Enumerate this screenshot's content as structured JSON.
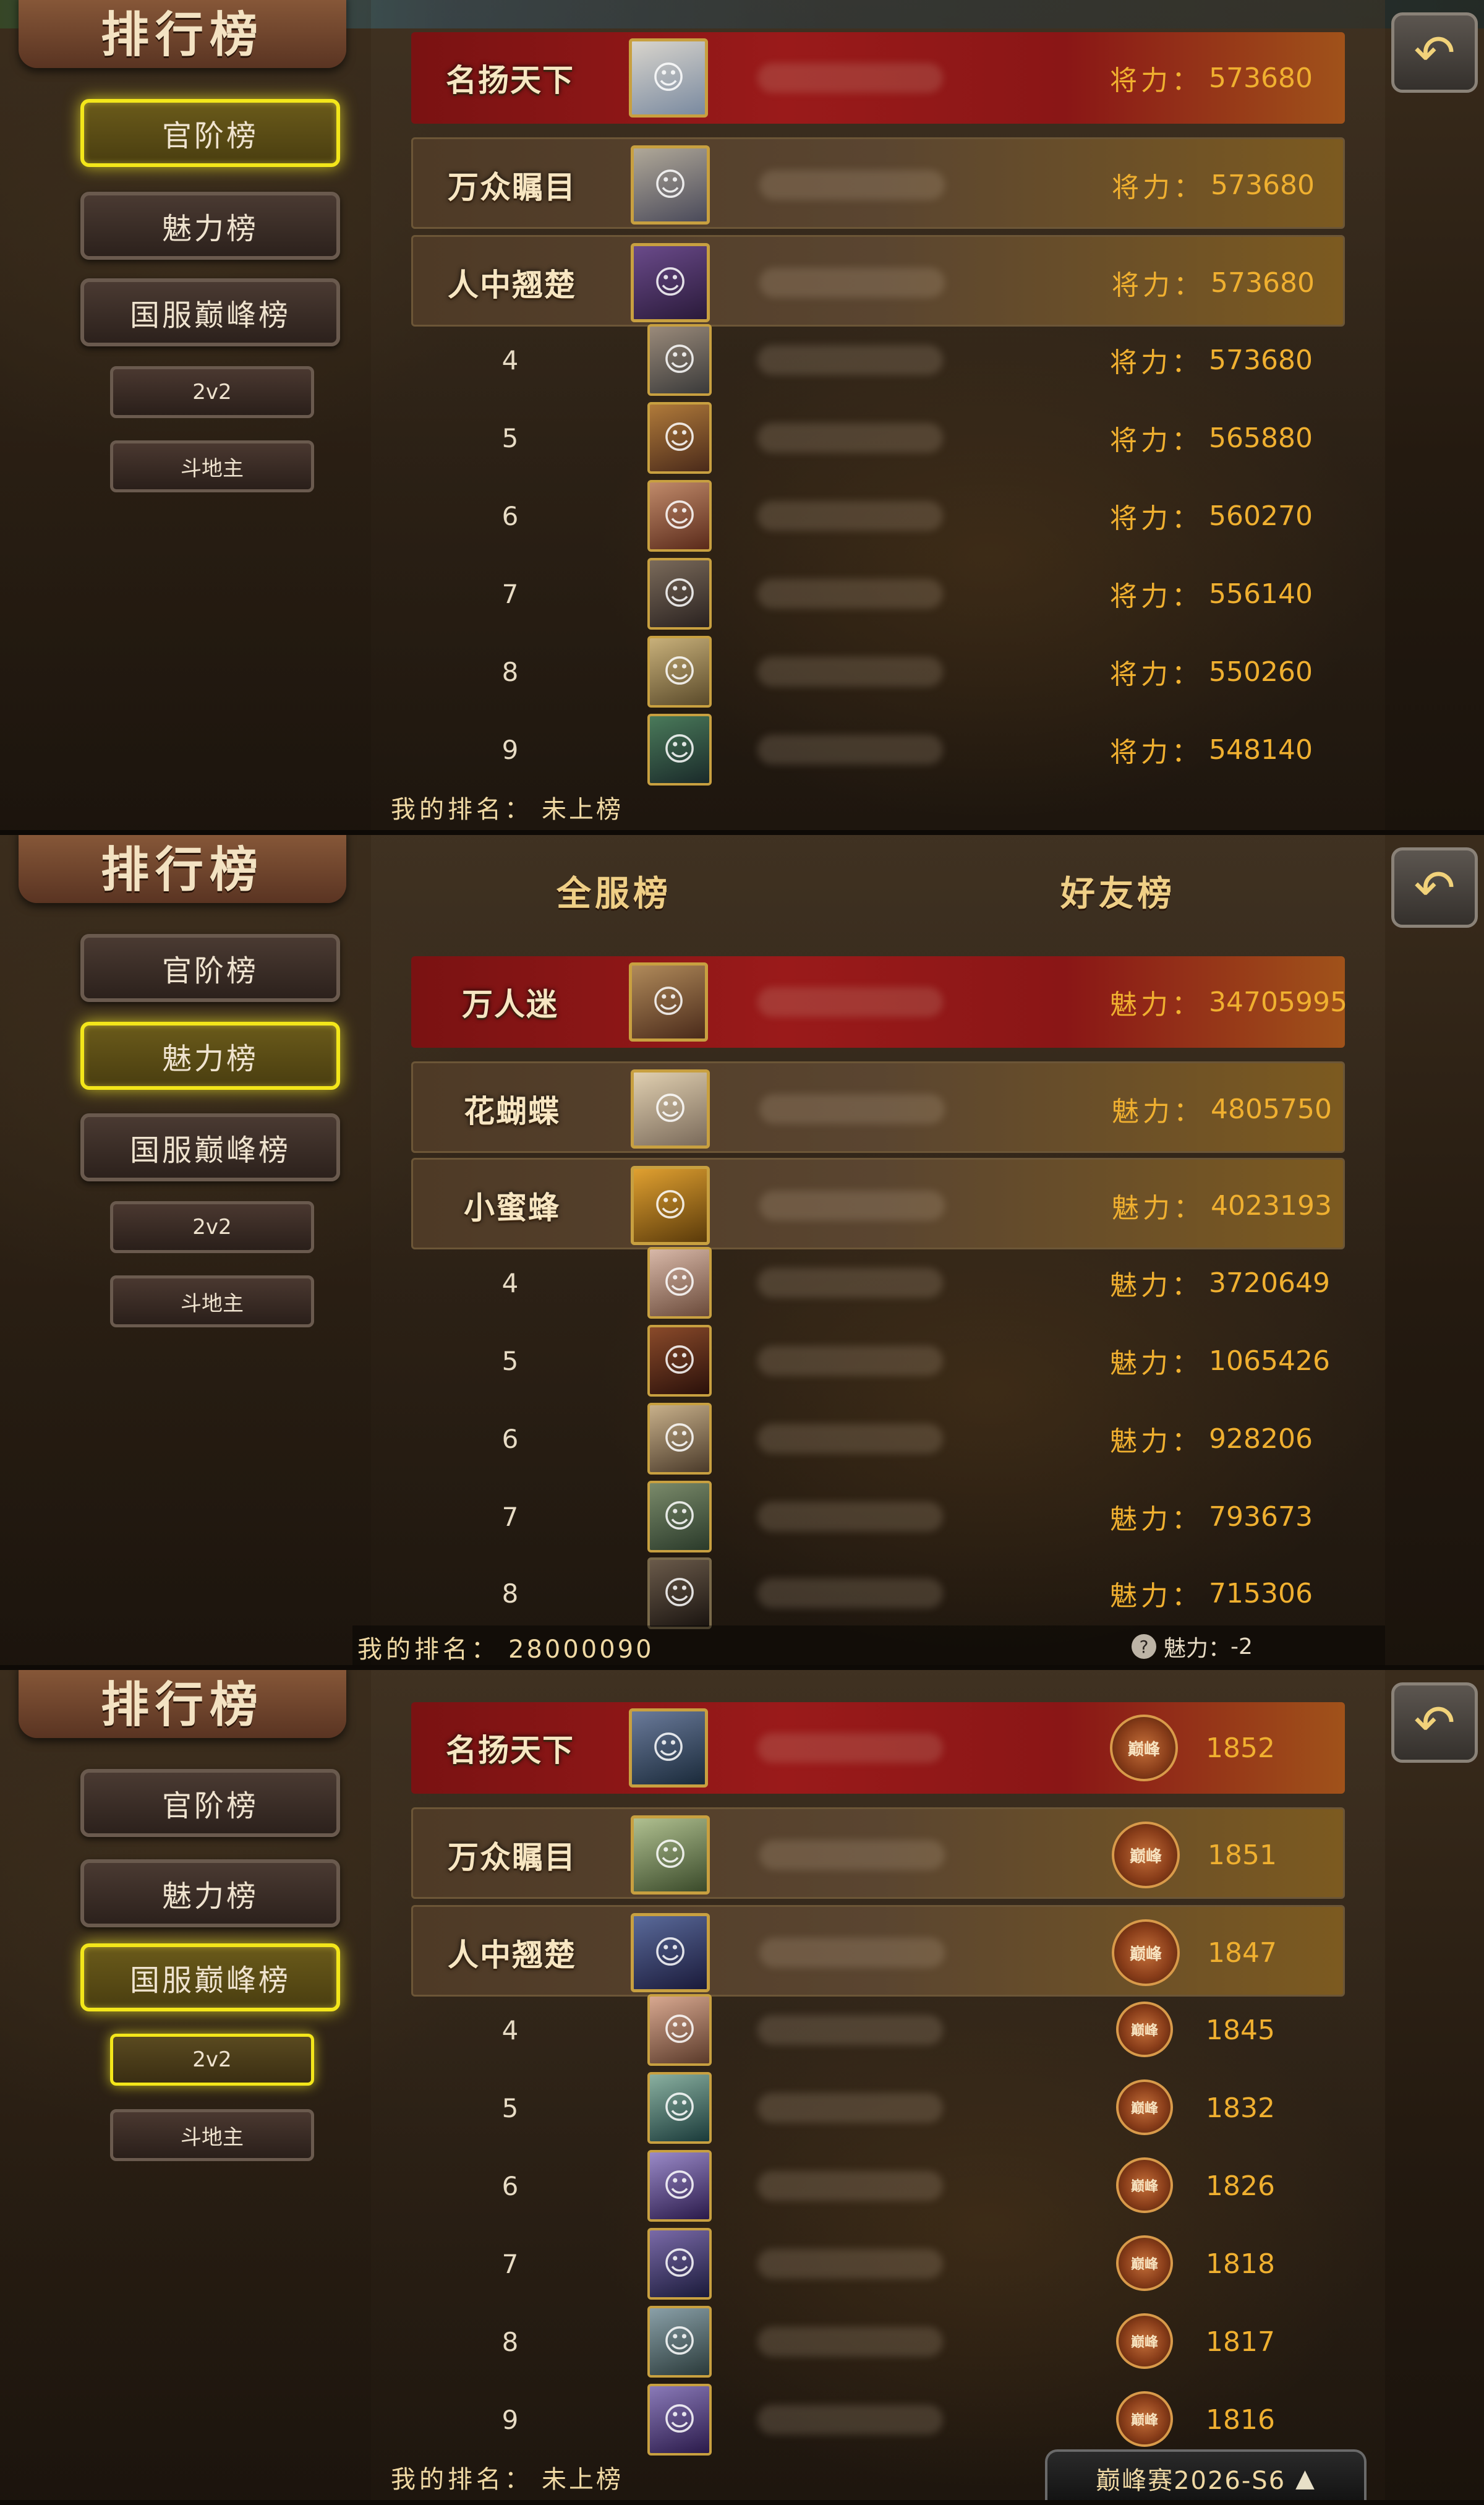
{
  "panels": [
    {
      "title": "排行榜",
      "nav": [
        "官阶榜",
        "魅力榜",
        "国服巅峰榜"
      ],
      "sub_nav": [
        "2v2",
        "斗地主"
      ],
      "active_nav": 0,
      "stat_label": "将力：",
      "rows": [
        {
          "rank": "1",
          "badge": "名扬天下",
          "value": "573680"
        },
        {
          "rank": "2",
          "badge": "万众瞩目",
          "value": "573680"
        },
        {
          "rank": "3",
          "badge": "人中翘楚",
          "value": "573680"
        },
        {
          "rank": "4",
          "value": "573680"
        },
        {
          "rank": "5",
          "value": "565880"
        },
        {
          "rank": "6",
          "value": "560270"
        },
        {
          "rank": "7",
          "value": "556140"
        },
        {
          "rank": "8",
          "value": "550260"
        },
        {
          "rank": "9",
          "value": "548140"
        }
      ],
      "my_rank_label": "我的排名：",
      "my_rank_value": "未上榜"
    },
    {
      "title": "排行榜",
      "nav": [
        "官阶榜",
        "魅力榜",
        "国服巅峰榜"
      ],
      "sub_nav": [
        "2v2",
        "斗地主"
      ],
      "active_nav": 1,
      "tabs": [
        "全服榜",
        "好友榜"
      ],
      "stat_label": "魅力：",
      "rows": [
        {
          "rank": "1",
          "badge": "万人迷",
          "value": "34705995"
        },
        {
          "rank": "2",
          "badge": "花蝴蝶",
          "value": "4805750"
        },
        {
          "rank": "3",
          "badge": "小蜜蜂",
          "value": "4023193"
        },
        {
          "rank": "4",
          "value": "3720649"
        },
        {
          "rank": "5",
          "value": "1065426"
        },
        {
          "rank": "6",
          "value": "928206"
        },
        {
          "rank": "7",
          "value": "793673"
        },
        {
          "rank": "8",
          "value": "715306"
        }
      ],
      "my_rank_label": "我的排名：",
      "my_rank_value": "28000090",
      "charm_help": "?",
      "charm_label": "魅力：",
      "charm_value": "-2"
    },
    {
      "title": "排行榜",
      "nav": [
        "官阶榜",
        "魅力榜",
        "国服巅峰榜"
      ],
      "sub_nav": [
        "2v2",
        "斗地主"
      ],
      "active_nav": 2,
      "peak_icon_text": "巅峰",
      "rows": [
        {
          "rank": "1",
          "badge": "名扬天下",
          "value": "1852"
        },
        {
          "rank": "2",
          "badge": "万众瞩目",
          "value": "1851"
        },
        {
          "rank": "3",
          "badge": "人中翘楚",
          "value": "1847"
        },
        {
          "rank": "4",
          "value": "1845"
        },
        {
          "rank": "5",
          "value": "1832"
        },
        {
          "rank": "6",
          "value": "1826"
        },
        {
          "rank": "7",
          "value": "1818"
        },
        {
          "rank": "8",
          "value": "1817"
        },
        {
          "rank": "9",
          "value": "1816"
        }
      ],
      "my_rank_label": "我的排名：",
      "my_rank_value": "未上榜",
      "season": "巅峰赛2026-S6",
      "season_arrow": "▲"
    }
  ],
  "back_icon": "↶",
  "avatar_icon": "☺",
  "colors": {
    "gold": "#f0b030",
    "active_border": "#f3e61a",
    "rank1_bg": "#8a1616"
  }
}
